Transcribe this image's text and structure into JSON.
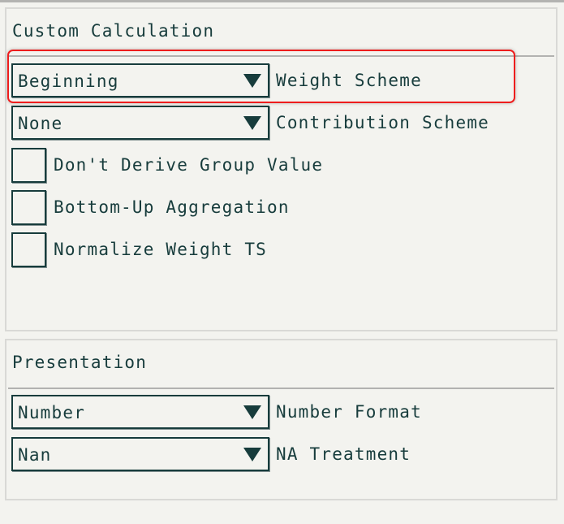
{
  "custom_calculation": {
    "title": "Custom Calculation",
    "dropdowns": [
      {
        "value": "Beginning",
        "label": "Weight Scheme",
        "highlighted": true
      },
      {
        "value": "None",
        "label": "Contribution Scheme",
        "highlighted": false
      }
    ],
    "checkboxes": [
      {
        "label": "Don't Derive Group Value",
        "checked": false
      },
      {
        "label": "Bottom-Up Aggregation",
        "checked": false
      },
      {
        "label": "Normalize Weight TS",
        "checked": false
      }
    ]
  },
  "presentation": {
    "title": "Presentation",
    "dropdowns": [
      {
        "value": "Number",
        "label": "Number Format"
      },
      {
        "value": "Nan",
        "label": "NA Treatment"
      }
    ]
  },
  "icons": {
    "dropdown_arrow": "caret-down-icon"
  },
  "colors": {
    "text": "#173c3c",
    "background": "#f3f3ef",
    "highlight": "#ee1d1d",
    "panel_border": "#d9d9d6",
    "divider": "#b2b2b0"
  }
}
